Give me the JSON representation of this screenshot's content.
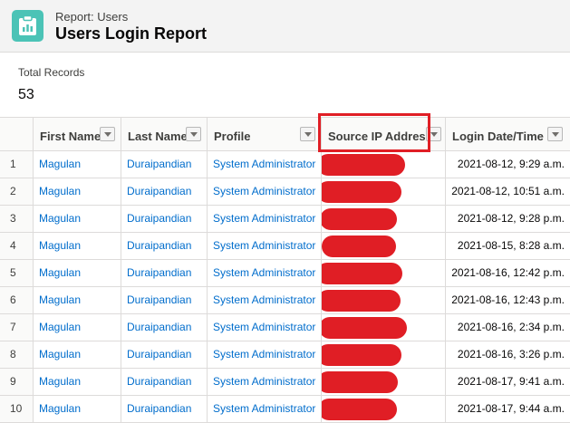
{
  "header": {
    "eyebrow": "Report: Users",
    "title": "Users Login Report",
    "icon": "report-chart-icon",
    "icon_color": "#4bc3b6"
  },
  "summary": {
    "label": "Total Records",
    "value": "53"
  },
  "table": {
    "columns": [
      {
        "label": "First Name"
      },
      {
        "label": "Last Name"
      },
      {
        "label": "Profile"
      },
      {
        "label": "Source IP Address"
      },
      {
        "label": "Login Date/Time"
      }
    ],
    "rows": [
      {
        "num": "1",
        "first": "Magulan",
        "last": "Duraipandian",
        "profile": "System Administrator",
        "ip": "",
        "datetime": "2021-08-12, 9:29 a.m."
      },
      {
        "num": "2",
        "first": "Magulan",
        "last": "Duraipandian",
        "profile": "System Administrator",
        "ip": "",
        "datetime": "2021-08-12, 10:51 a.m."
      },
      {
        "num": "3",
        "first": "Magulan",
        "last": "Duraipandian",
        "profile": "System Administrator",
        "ip": "",
        "datetime": "2021-08-12, 9:28 p.m."
      },
      {
        "num": "4",
        "first": "Magulan",
        "last": "Duraipandian",
        "profile": "System Administrator",
        "ip": "",
        "datetime": "2021-08-15, 8:28 a.m."
      },
      {
        "num": "5",
        "first": "Magulan",
        "last": "Duraipandian",
        "profile": "System Administrator",
        "ip": "",
        "datetime": "2021-08-16, 12:42 p.m."
      },
      {
        "num": "6",
        "first": "Magulan",
        "last": "Duraipandian",
        "profile": "System Administrator",
        "ip": "",
        "datetime": "2021-08-16, 12:43 p.m."
      },
      {
        "num": "7",
        "first": "Magulan",
        "last": "Duraipandian",
        "profile": "System Administrator",
        "ip": "",
        "datetime": "2021-08-16, 2:34 p.m."
      },
      {
        "num": "8",
        "first": "Magulan",
        "last": "Duraipandian",
        "profile": "System Administrator",
        "ip": "",
        "datetime": "2021-08-16, 3:26 p.m."
      },
      {
        "num": "9",
        "first": "Magulan",
        "last": "Duraipandian",
        "profile": "System Administrator",
        "ip": "",
        "datetime": "2021-08-17, 9:41 a.m."
      },
      {
        "num": "10",
        "first": "Magulan",
        "last": "Duraipandian",
        "profile": "System Administrator",
        "ip": "",
        "datetime": "2021-08-17, 9:44 a.m."
      }
    ]
  },
  "colors": {
    "link": "#006dcc",
    "redaction": "#e01e25",
    "header_bg": "#f3f3f3"
  }
}
